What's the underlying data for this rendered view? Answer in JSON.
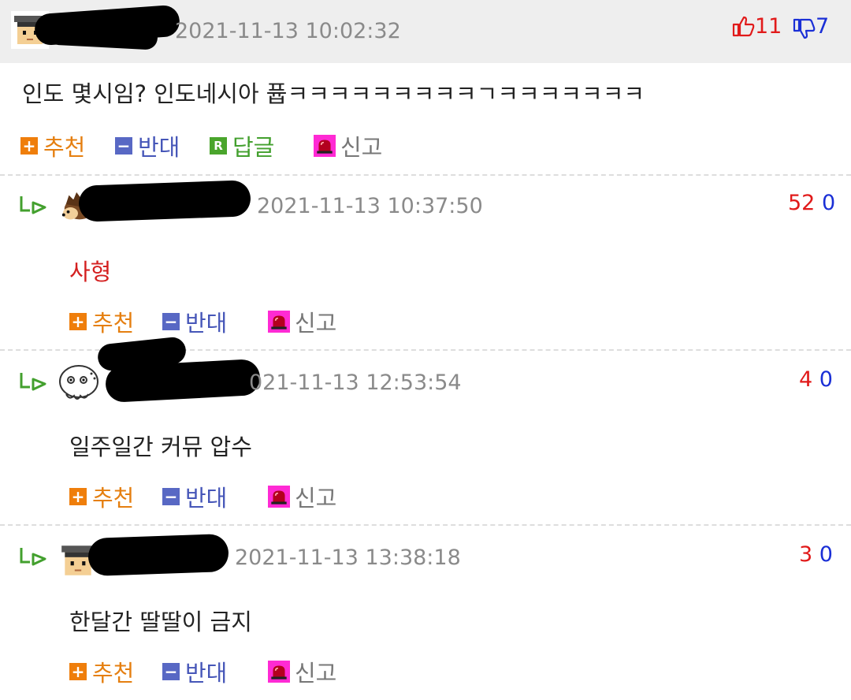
{
  "comments": [
    {
      "timestamp": "2021-11-13 10:02:32",
      "upvotes": "11",
      "downvotes": "7",
      "text": "인도 몇시임? 인도네시아 퓹ㅋㅋㅋㅋㅋㅋㅋㅋㅋㄱㅋㅋㅋㅋㅋㅋㅋ",
      "actions": {
        "recommend": "추천",
        "oppose": "반대",
        "reply": "답글",
        "report": "신고"
      }
    },
    {
      "timestamp": "2021-11-13 10:37:50",
      "upvotes": "52",
      "downvotes": "0",
      "text": "사형",
      "actions": {
        "recommend": "추천",
        "oppose": "반대",
        "report": "신고"
      }
    },
    {
      "timestamp": "021-11-13 12:53:54",
      "upvotes": "4",
      "downvotes": "0",
      "text": "일주일간 커뮤 압수",
      "actions": {
        "recommend": "추천",
        "oppose": "반대",
        "report": "신고"
      }
    },
    {
      "timestamp": "2021-11-13 13:38:18",
      "upvotes": "3",
      "downvotes": "0",
      "text": "한달간 딸딸이 금지",
      "actions": {
        "recommend": "추천",
        "oppose": "반대",
        "report": "신고"
      }
    }
  ],
  "icons": {
    "recommend": "plus-box-icon",
    "oppose": "minus-box-icon",
    "reply": "r-box-icon",
    "report": "siren-icon",
    "thumbs_up": "thumbs-up-icon",
    "thumbs_down": "thumbs-down-icon",
    "reply_indicator": "reply-arrow-icon"
  },
  "icon_glyphs": {
    "plus": "+",
    "minus": "−",
    "r": "R"
  },
  "colors": {
    "upvote": "#e11a1a",
    "downvote": "#1a2fd6",
    "recommend": "#ef7e0b",
    "oppose": "#5868c4",
    "reply": "#4aa52c",
    "report": "#ff00ff"
  }
}
